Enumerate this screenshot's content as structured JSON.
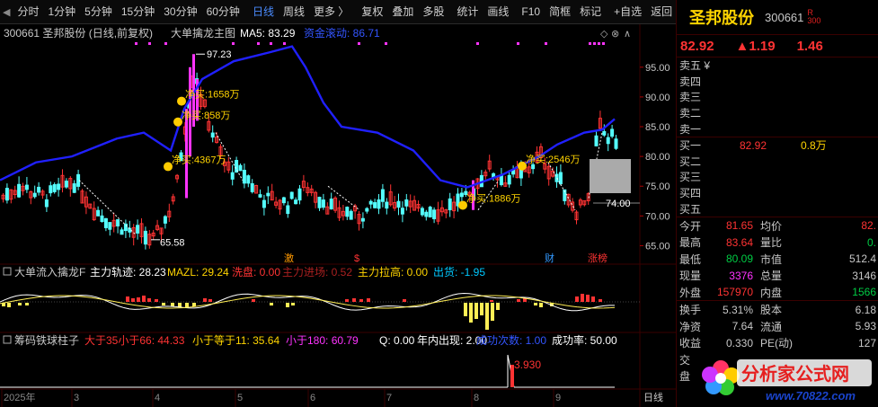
{
  "toolbar": {
    "items": [
      "分时",
      "1分钟",
      "5分钟",
      "15分钟",
      "30分钟",
      "60分钟",
      "日线",
      "周线",
      "更多 〉",
      "复权",
      "叠加",
      "多股",
      "统计",
      "画线",
      "F10",
      "简框",
      "标记",
      "+自选",
      "返回"
    ],
    "active": "日线"
  },
  "main_chart": {
    "legend_stock": "300661  圣邦股份 (日线,前复权)",
    "legend_indicator": "大单擒龙主图",
    "legend_ma5": "MA5: 83.29",
    "legend_extra": "资金滚动: 86.71",
    "y_ticks": [
      "95.00",
      "90.00",
      "85.00",
      "80.00",
      "75.00",
      "70.00",
      "65.00"
    ],
    "price_high": "97.23",
    "price_low": "65.58",
    "price_mark": "74.00",
    "annotations": [
      "净买:1658万",
      "净买:858万",
      "净买:4367万",
      "净买:1886万",
      "净买:2546万"
    ],
    "event_tags": [
      "激",
      "$",
      "财",
      "涨榜"
    ]
  },
  "sub1": {
    "title": "大单流入擒龙F",
    "fields": [
      {
        "label": "主力轨迹: 28.23",
        "color": "#ffffff"
      },
      {
        "label": "MAZL: 29.24",
        "color": "#ffd400"
      },
      {
        "label": "洗盘: 0.00",
        "color": "#ff3333"
      },
      {
        "label": "主力进场: 0.52",
        "color": "#aa2020"
      },
      {
        "label": "主力拉高: 0.00",
        "color": "#ffd400"
      },
      {
        "label": "出货: -1.95",
        "color": "#00c8ff"
      }
    ]
  },
  "sub2": {
    "title": "筹码铁球柱子",
    "fields": [
      {
        "label": "大于35小于66: 44.33",
        "color": "#ff3333"
      },
      {
        "label": "小于等于11: 35.64",
        "color": "#ffd400"
      },
      {
        "label": "小于180: 60.79",
        "color": "#ff33ff"
      },
      {
        "label": "Q: 0.00",
        "color": "#ffffff"
      },
      {
        "label": "年内出现: 2.00",
        "color": "#ffffff"
      },
      {
        "label": "成功次数: 1.00",
        "color": "#3355ff"
      },
      {
        "label": "成功率: 50.00",
        "color": "#ffffff"
      }
    ],
    "bar_label": "3.930"
  },
  "xaxis": {
    "labels": [
      "2025年",
      "3",
      "4",
      "5",
      "6",
      "7",
      "8",
      "9"
    ],
    "period": "日线"
  },
  "quote": {
    "name": "圣邦股份",
    "code": "300661",
    "badge": "R\n300",
    "price": "82.92",
    "change": "▲1.19",
    "pct": "1.46",
    "asks": [
      {
        "label": "卖五 ¥",
        "price": "",
        "vol": ""
      },
      {
        "label": "卖四",
        "price": "",
        "vol": ""
      },
      {
        "label": "卖三",
        "price": "",
        "vol": ""
      },
      {
        "label": "卖二",
        "price": "",
        "vol": ""
      },
      {
        "label": "卖一",
        "price": "",
        "vol": ""
      }
    ],
    "bids": [
      {
        "label": "买一",
        "price": "82.92",
        "vol": "0.8万"
      },
      {
        "label": "买二",
        "price": "",
        "vol": ""
      },
      {
        "label": "买三",
        "price": "",
        "vol": ""
      },
      {
        "label": "买四",
        "price": "",
        "vol": ""
      },
      {
        "label": "买五",
        "price": "",
        "vol": ""
      }
    ],
    "stats": [
      {
        "l1": "今开",
        "v1": "81.65",
        "c1": "red",
        "l2": "均价",
        "v2": "82.",
        "c2": "red"
      },
      {
        "l1": "最高",
        "v1": "83.64",
        "c1": "red",
        "l2": "量比",
        "v2": "0.",
        "c2": "green"
      },
      {
        "l1": "最低",
        "v1": "80.09",
        "c1": "green",
        "l2": "市值",
        "v2": "512.4",
        "c2": "wht"
      },
      {
        "l1": "现量",
        "v1": "3376",
        "c1": "mag",
        "l2": "总量",
        "v2": "3146",
        "c2": "wht"
      },
      {
        "l1": "外盘",
        "v1": "157970",
        "c1": "red",
        "l2": "内盘",
        "v2": "1566",
        "c2": "green"
      }
    ],
    "stats2": [
      {
        "l1": "换手",
        "v1": "5.31%",
        "c1": "wht",
        "l2": "股本",
        "v2": "6.18",
        "c2": "wht"
      },
      {
        "l1": "净资",
        "v1": "7.64",
        "c1": "wht",
        "l2": "流通",
        "v2": "5.93",
        "c2": "wht"
      },
      {
        "l1": "收益",
        "v1": "0.330",
        "c1": "wht",
        "l2": "PE(动)",
        "v2": "127",
        "c2": "wht"
      },
      {
        "l1": "交",
        "v1": "",
        "c1": "wht",
        "l2": "",
        "v2": "",
        "c2": "wht"
      },
      {
        "l1": "盘",
        "v1": "",
        "c1": "wht",
        "l2": "",
        "v2": "",
        "c2": "wht"
      }
    ]
  },
  "watermark": {
    "title": "分析家公式网",
    "url": "www.70822.com"
  }
}
